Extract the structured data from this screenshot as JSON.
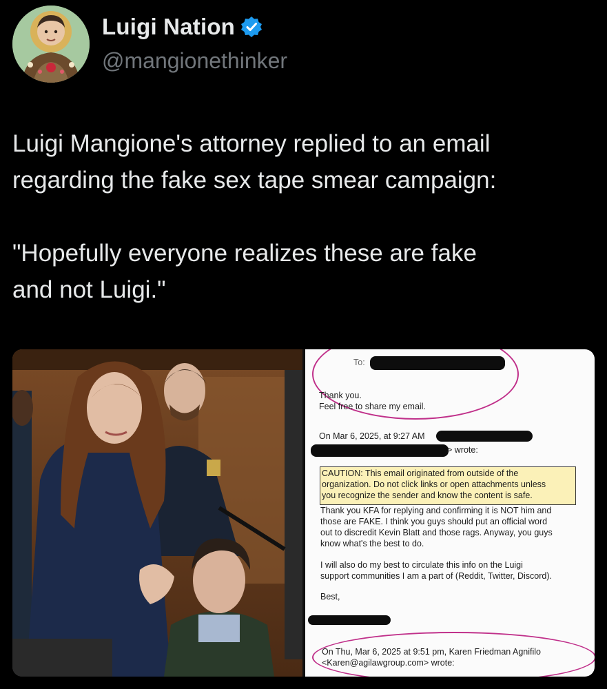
{
  "account": {
    "display_name": "Luigi Nation",
    "handle": "@mangionethinker",
    "verified_color": "#1d9bf0",
    "avatar": "religious-icon-portrait"
  },
  "tweet": {
    "line1": "Luigi Mangione's attorney replied to an email",
    "line2": "regarding the fake sex tape smear campaign:",
    "line3": "\"Hopefully everyone realizes these are fake",
    "line4": "and not Luigi.\""
  },
  "email": {
    "to_label": "To:",
    "thank_you": "Thank you.",
    "share": "Feel free to share my email.",
    "on_date": "On Mar 6, 2025, at 9:27 AM",
    "wrote": "> wrote:",
    "caution_1": "CAUTION: This email originated from outside of the",
    "caution_2": "organization. Do not click links or open attachments unless",
    "caution_3": "you recognize the sender and know the content is safe.",
    "body_1": "Thank you KFA for replying and confirming it is NOT him and",
    "body_2": "those are FAKE. I think you guys should put an official word",
    "body_3": "out to discredit Kevin Blatt and those rags. Anyway, you guys",
    "body_4": "know what's the best to do.",
    "body_5": "I will also do my best to circulate this info on the Luigi",
    "body_6": "support communities I am a part of (Reddit, Twitter, Discord).",
    "best": "Best,",
    "footer_1": "On Thu, Mar 6, 2025 at 9:51 pm, Karen Friedman Agnifilo",
    "footer_2": "<Karen@agilawgroup.com> wrote:"
  },
  "colors": {
    "background": "#000000",
    "text": "#e7e9ea",
    "handle": "#71767b",
    "annotation": "#c0308a",
    "caution_bg": "#fbf1b8"
  }
}
